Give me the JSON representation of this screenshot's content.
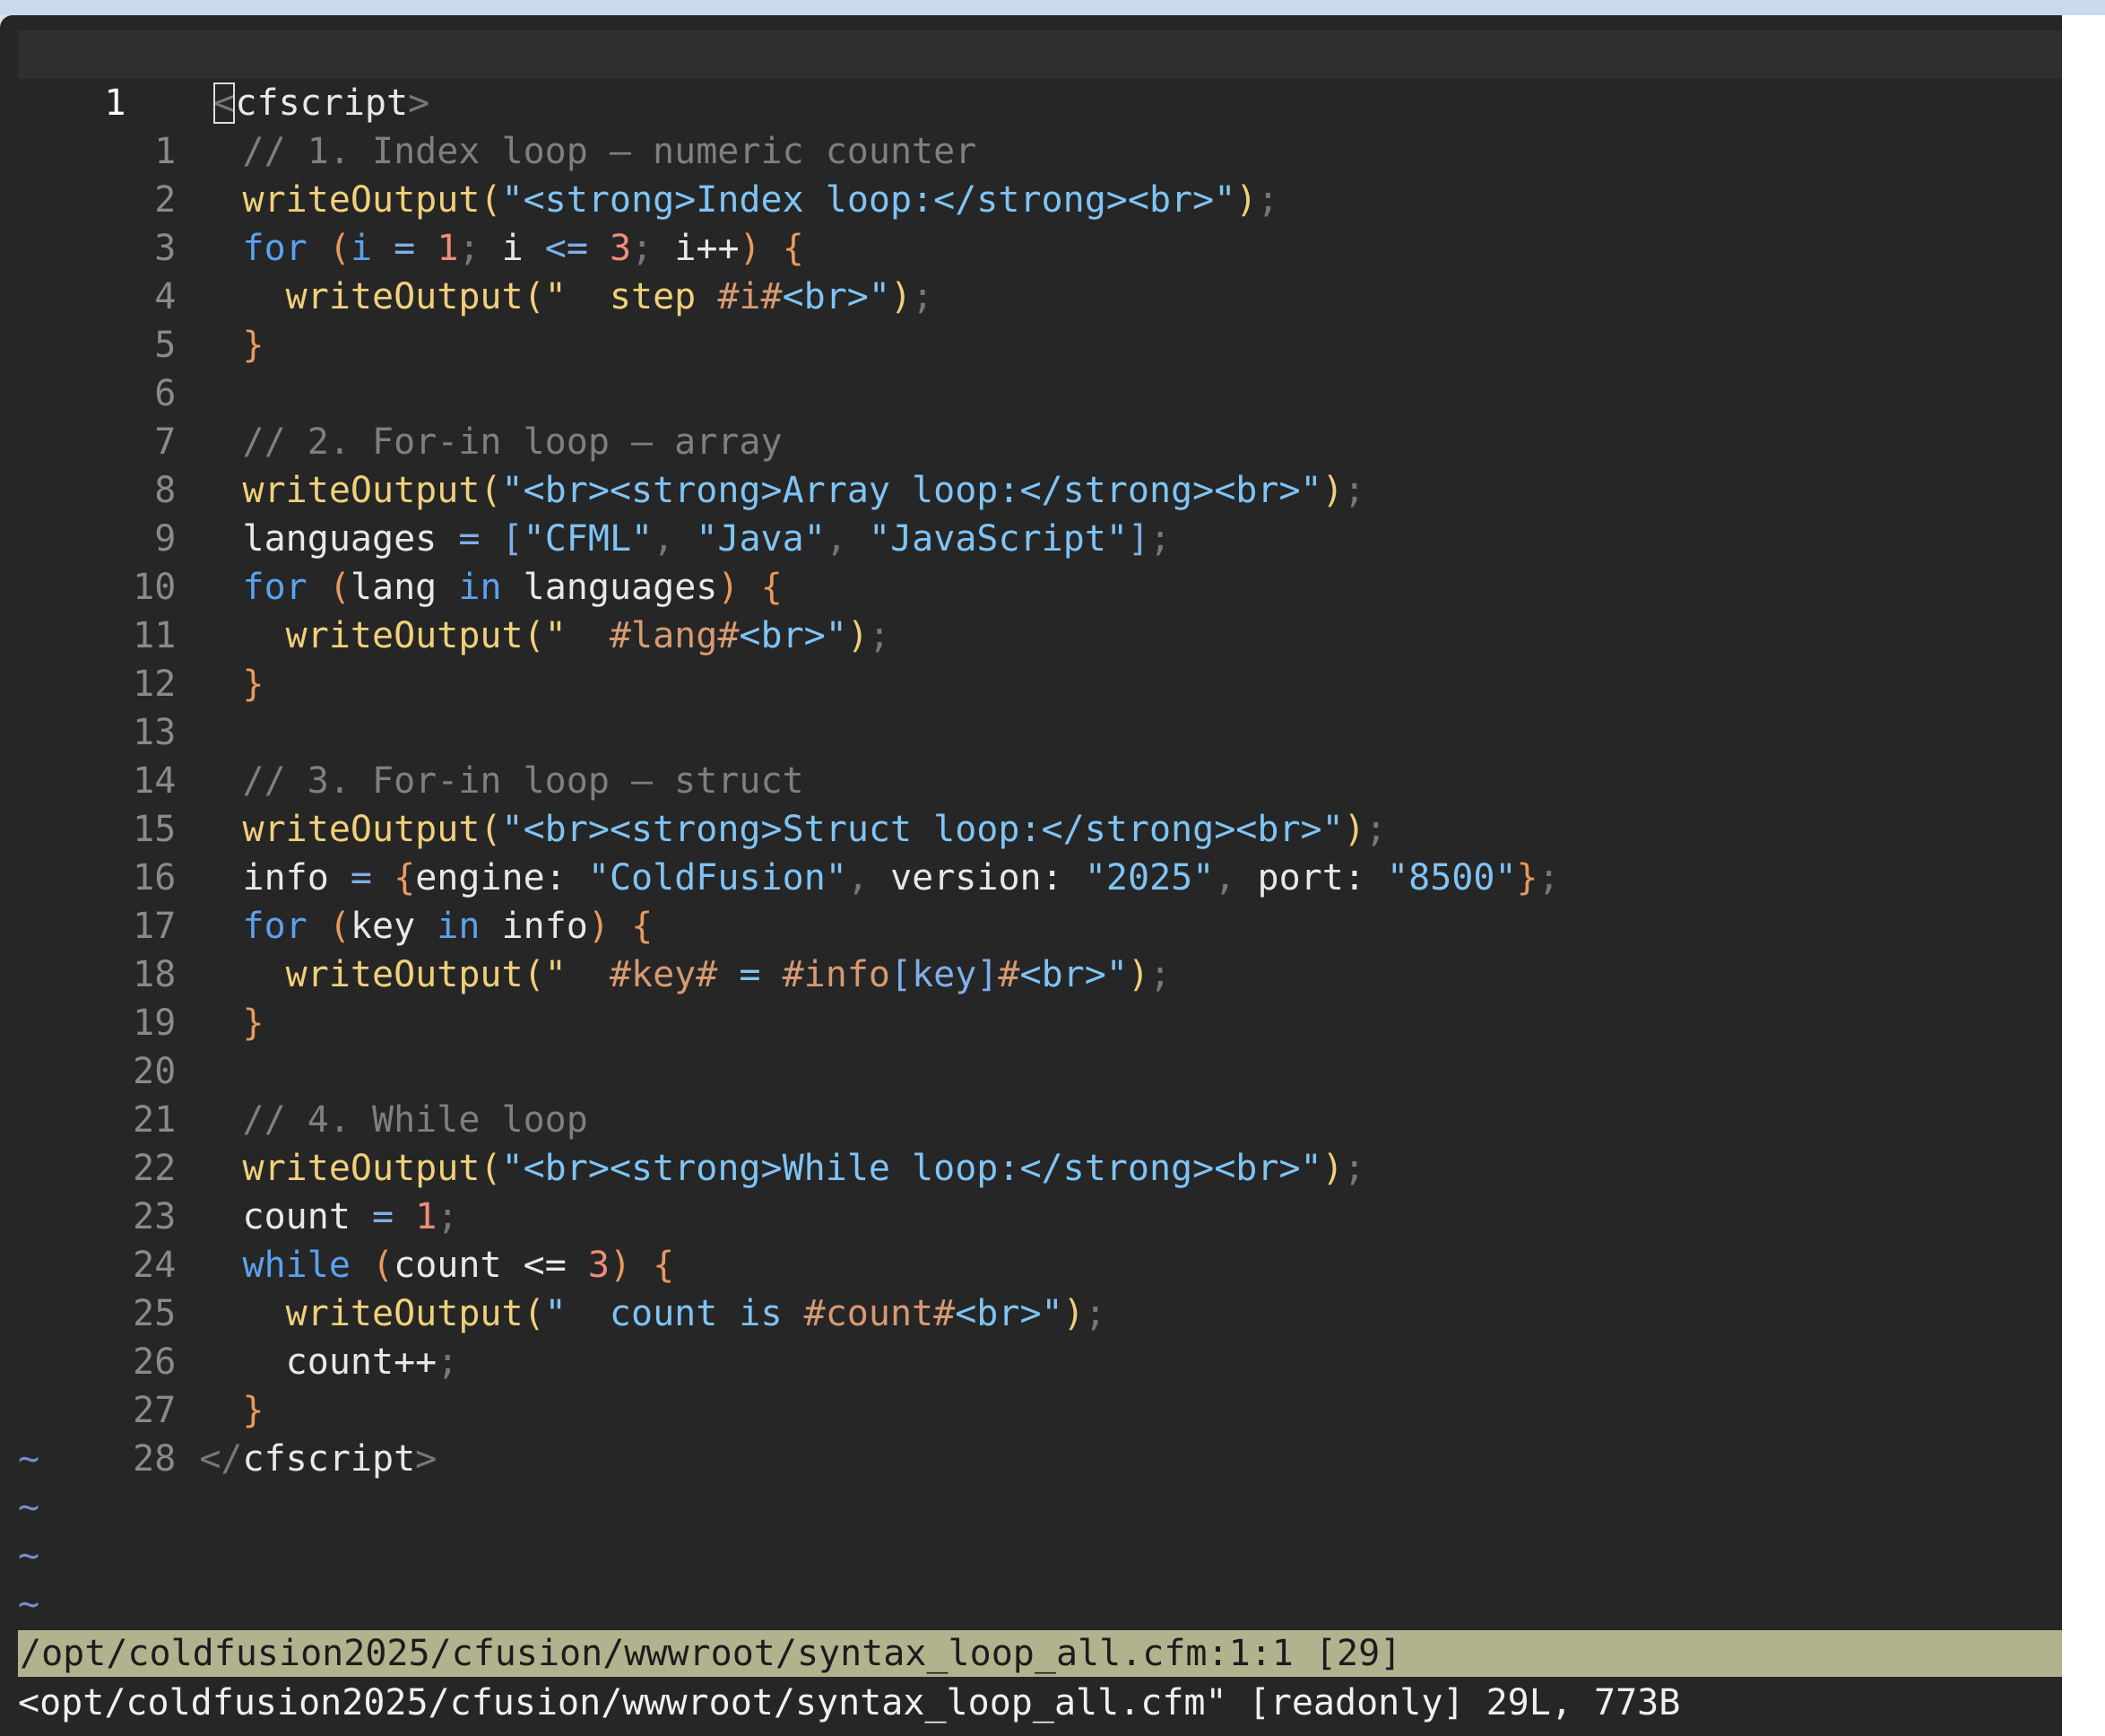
{
  "editor": {
    "header_line_number": "1",
    "open_tag": "cfscript",
    "close_tag": "cfscript",
    "line_numbers": [
      "1",
      "2",
      "3",
      "4",
      "5",
      "6",
      "7",
      "8",
      "9",
      "10",
      "11",
      "12",
      "13",
      "14",
      "15",
      "16",
      "17",
      "18",
      "19",
      "20",
      "21",
      "22",
      "23",
      "24",
      "25",
      "26",
      "27",
      "28"
    ],
    "comments": {
      "c1": "// 1. Index loop — numeric counter",
      "c2": "// 2. For-in loop — array",
      "c3": "// 3. For-in loop — struct",
      "c4": "// 4. While loop"
    },
    "strings": {
      "s2": "\"<strong>Index loop:</strong><br>\"",
      "s4a": "\"  step ",
      "s4b": "#i#",
      "s4c": "<br>\"",
      "s8": "\"<br><strong>Array loop:</strong><br>\"",
      "s9a": "\"CFML\"",
      "s9b": "\"Java\"",
      "s9c": "\"JavaScript\"",
      "s11a": "\"  ",
      "s11b": "#lang#",
      "s11c": "<br>\"",
      "s15": "\"<br><strong>Struct loop:</strong><br>\"",
      "s16a": "\"ColdFusion\"",
      "s16b": "\"2025\"",
      "s16c": "\"8500\"",
      "s18a": "\"  ",
      "s18b": "#key#",
      "s18c": " = ",
      "s18d": "#info",
      "s18e": "[key]",
      "s18f": "#",
      "s18g": "<br>\"",
      "s22": "\"<br><strong>While loop:</strong><br>\"",
      "s25a": "\"  count is ",
      "s25b": "#count#",
      "s25c": "<br>\""
    },
    "identifiers": {
      "writeOutput": "writeOutput",
      "for": "for",
      "in": "in",
      "while": "while",
      "i": "i",
      "languages": "languages",
      "lang": "lang",
      "info": "info",
      "key": "key",
      "count": "count",
      "engine": "engine",
      "version": "version",
      "port": "port"
    },
    "numbers": {
      "one": "1",
      "three": "3"
    },
    "empty_line_markers": [
      "~",
      "~",
      "~",
      "~"
    ]
  },
  "statusbar": {
    "text": "/opt/coldfusion2025/cfusion/wwwroot/syntax_loop_all.cfm:1:1 [29]"
  },
  "cmdline": {
    "text": "<opt/coldfusion2025/cfusion/wwwroot/syntax_loop_all.cfm\" [readonly] 29L, 773B"
  },
  "colors": {
    "background": "#262626",
    "cursorline": "#2f2f2f",
    "statusbar": "#b3b28f",
    "function": "#f0d07a",
    "string": "#7fc4f5",
    "keyword": "#5aa2ee",
    "number": "#f08d7a",
    "comment": "#7f7f7f",
    "tilde": "#6f8fd0"
  }
}
